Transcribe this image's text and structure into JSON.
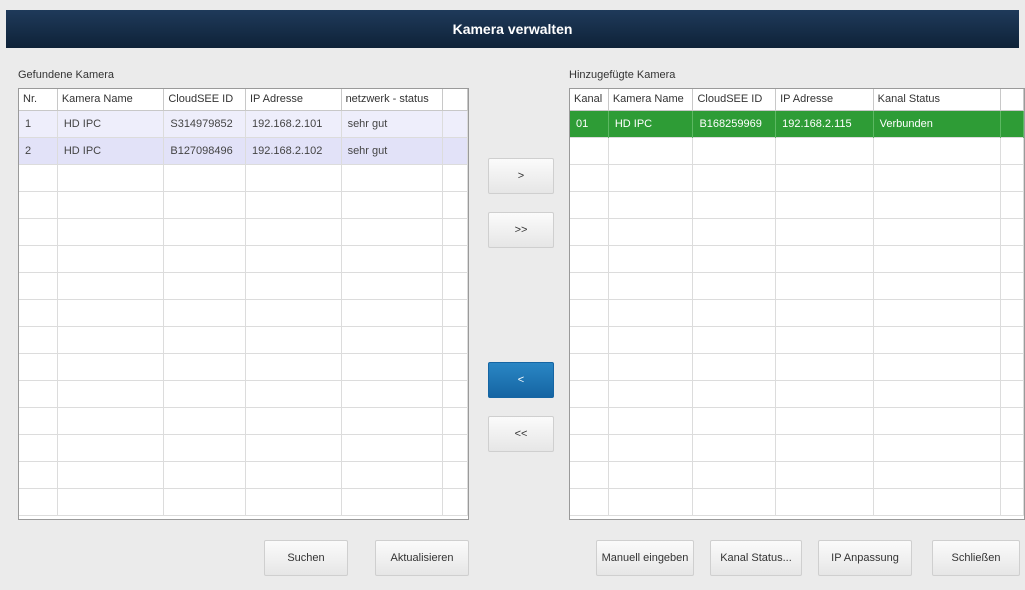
{
  "window": {
    "title": "Kamera verwalten"
  },
  "found": {
    "label": "Gefundene Kamera",
    "columns": [
      "Nr.",
      "Kamera Name",
      "CloudSEE ID",
      "IP Adresse",
      "netzwerk - status",
      ""
    ],
    "rows": [
      [
        "1",
        "HD IPC",
        "S314979852",
        "192.168.2.101",
        "sehr gut",
        ""
      ],
      [
        "2",
        "HD IPC",
        "B127098496",
        "192.168.2.102",
        "sehr gut",
        ""
      ]
    ]
  },
  "added": {
    "label": "Hinzugefügte Kamera",
    "columns": [
      "Kanal",
      "Kamera Name",
      "CloudSEE ID",
      "IP Adresse",
      "Kanal Status",
      ""
    ],
    "rows": [
      [
        "01",
        "HD IPC",
        "B168259969",
        "192.168.2.115",
        "Verbunden",
        ""
      ]
    ]
  },
  "transfer": {
    "add_one": ">",
    "add_all": ">>",
    "remove_one": "<",
    "remove_all": "<<"
  },
  "buttons": {
    "search": "Suchen",
    "refresh": "Aktualisieren",
    "manual": "Manuell eingeben",
    "channel_status": "Kanal Status...",
    "ip_adjust": "IP Anpassung",
    "close": "Schließen"
  },
  "colors": {
    "title_bar": "#132c47",
    "selected_row": "#2e9c36",
    "active_button": "#1e74b5",
    "row_tint_1": "#eeeefb",
    "row_tint_2": "#e2e2f8"
  }
}
